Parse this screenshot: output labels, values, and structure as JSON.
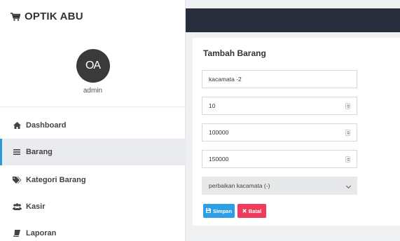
{
  "brand": {
    "title": "OPTIK ABU",
    "icon": "cart-icon"
  },
  "profile": {
    "avatar_text": "OA",
    "name": "admin"
  },
  "sidebar": {
    "items": [
      {
        "label": "Dashboard",
        "icon": "home-icon",
        "active": false
      },
      {
        "label": "Barang",
        "icon": "bars-icon",
        "active": true
      },
      {
        "label": "Kategori Barang",
        "icon": "tags-icon",
        "active": false
      },
      {
        "label": "Kasir",
        "icon": "users-icon",
        "active": false
      },
      {
        "label": "Laporan",
        "icon": "book-icon",
        "active": false
      }
    ]
  },
  "form": {
    "title": "Tambah Barang",
    "nama": "kacamata -2",
    "stok": "10",
    "harga_beli": "100000",
    "harga_jual": "150000",
    "kategori": "perbaikan kacamata (-)",
    "save_label": "Simpan",
    "cancel_label": "Batal"
  },
  "colors": {
    "topbar": "#272d3a",
    "accent": "#2d9ad8",
    "save": "#2e9fe6",
    "cancel": "#ef3c5b"
  }
}
